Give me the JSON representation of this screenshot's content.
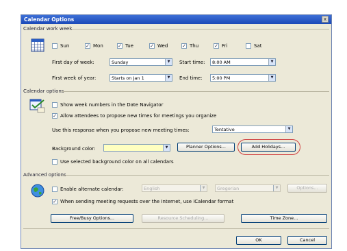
{
  "window": {
    "title": "Calendar Options",
    "close_glyph": "x"
  },
  "work_week": {
    "group_label": "Calendar work week",
    "days": [
      {
        "label": "Sun",
        "checked": false
      },
      {
        "label": "Mon",
        "checked": true
      },
      {
        "label": "Tue",
        "checked": true
      },
      {
        "label": "Wed",
        "checked": true
      },
      {
        "label": "Thu",
        "checked": true
      },
      {
        "label": "Fri",
        "checked": true
      },
      {
        "label": "Sat",
        "checked": false
      }
    ],
    "first_day_label": "First day of week:",
    "first_day_value": "Sunday",
    "start_time_label": "Start time:",
    "start_time_value": "8:00 AM",
    "first_week_label": "First week of year:",
    "first_week_value": "Starts on Jan 1",
    "end_time_label": "End time:",
    "end_time_value": "5:00 PM"
  },
  "calendar_options": {
    "group_label": "Calendar options",
    "show_week_numbers_label": "Show week numbers in the Date Navigator",
    "show_week_numbers_checked": false,
    "allow_propose_label": "Allow attendees to propose new times for meetings you organize",
    "allow_propose_checked": true,
    "response_label": "Use this response when you propose new meeting times:",
    "response_value": "Tentative",
    "background_color_label": "Background color:",
    "background_color_value": "#ffffc0",
    "planner_options_label": "Planner Options...",
    "add_holidays_label": "Add Holidays...",
    "use_bg_all_label": "Use selected background color on all calendars",
    "use_bg_all_checked": false,
    "highlight_color": "#d04040"
  },
  "advanced": {
    "group_label": "Advanced options",
    "alt_calendar_label": "Enable alternate calendar:",
    "alt_calendar_checked": false,
    "language_value": "English",
    "calendar_value": "Gregorian",
    "options_label": "Options...",
    "icalendar_label": "When sending meeting requests over the Internet, use iCalendar format",
    "icalendar_checked": true,
    "freebusy_label": "Free/Busy Options...",
    "resource_label": "Resource Scheduling...",
    "timezone_label": "Time Zone..."
  },
  "footer": {
    "ok_label": "OK",
    "cancel_label": "Cancel"
  },
  "icons": {
    "calendar": "calendar-grid-icon",
    "options": "calendar-options-icon",
    "globe": "globe-icon"
  }
}
